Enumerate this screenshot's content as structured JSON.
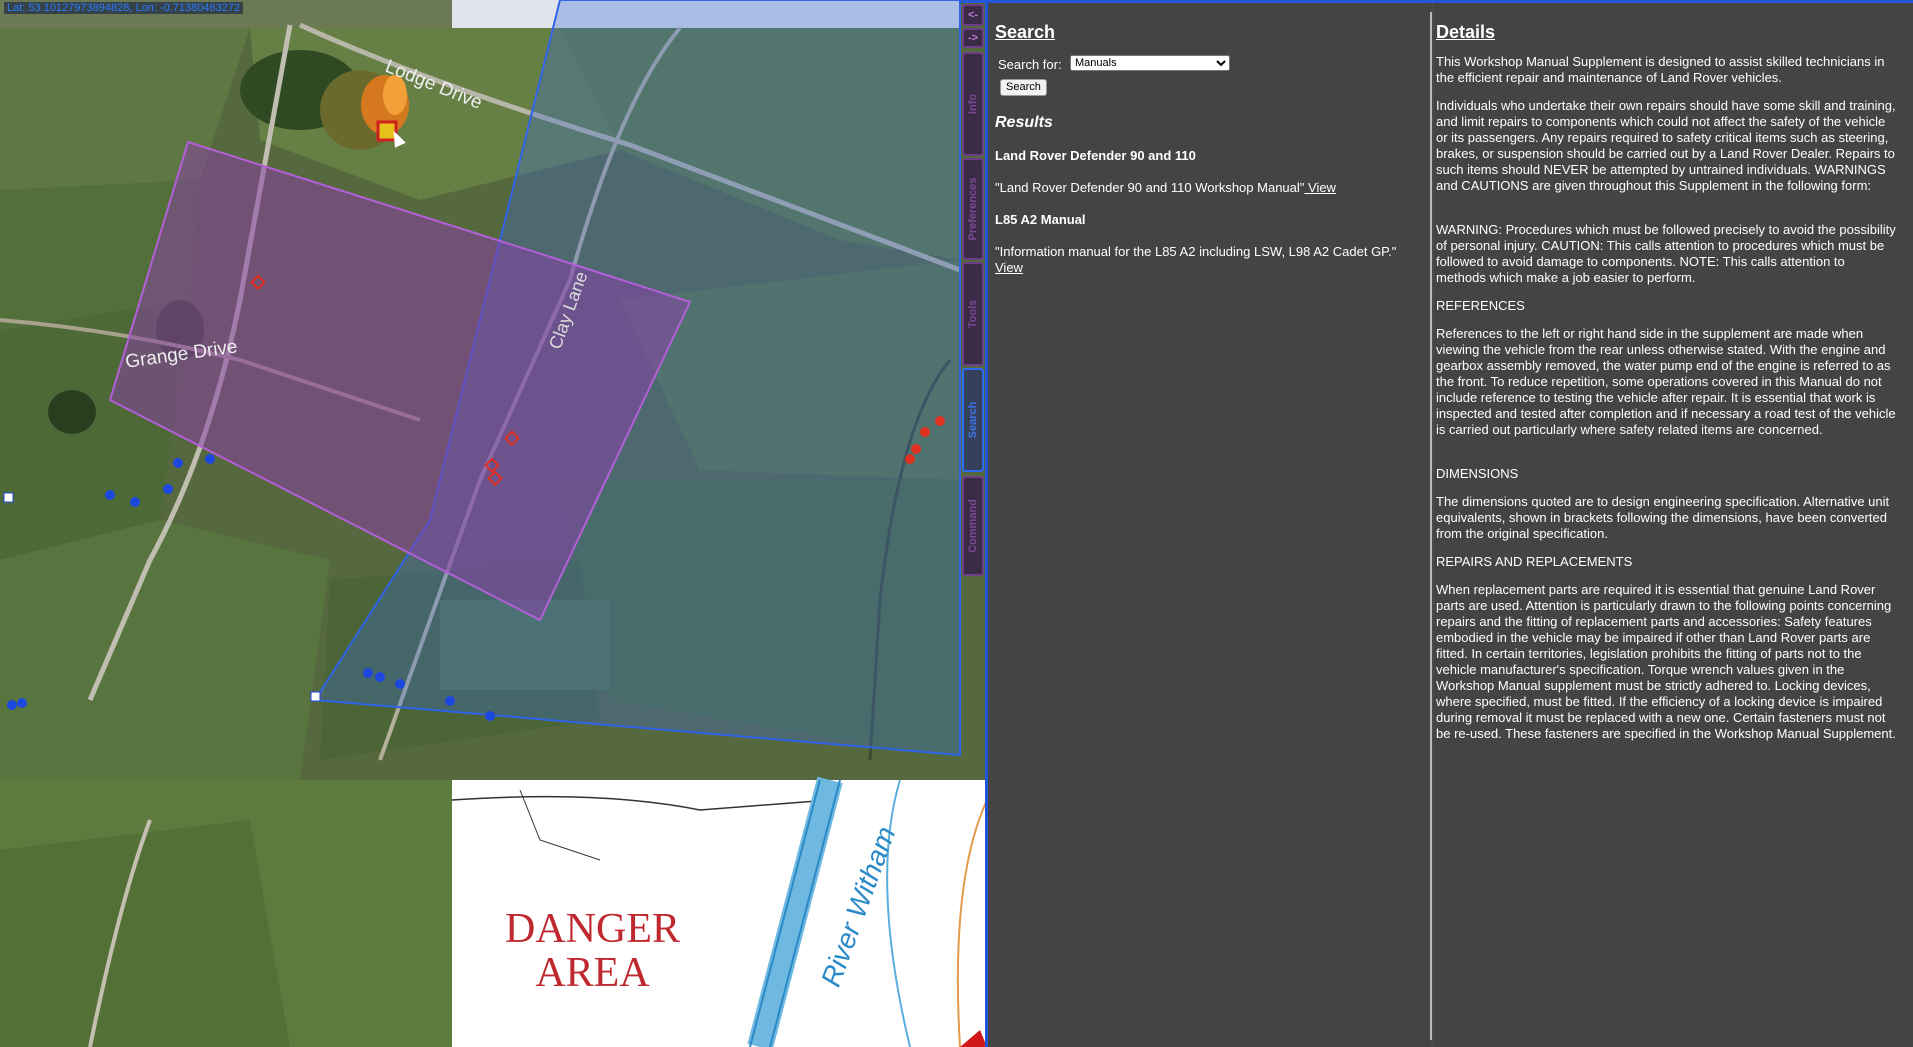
{
  "map": {
    "coords": "Lat: 53.10127973894828, Lon: -0.71380463272",
    "labels": {
      "lodge_drive": "Lodge Drive",
      "clay_lane": "Clay Lane",
      "grange_drive": "Grange Drive",
      "river": "River Witham",
      "danger_line1": "DANGER",
      "danger_line2": "AREA"
    },
    "colors": {
      "purple_zone": "#8a3fa8",
      "blue_zone": "#3c6cd8",
      "red_marker": "#e03020",
      "blue_marker": "#1c48e0"
    }
  },
  "tabs": {
    "back": "<-",
    "forward": "->",
    "info": "Info",
    "preferences": "Preferences",
    "tools": "Tools",
    "search": "Search",
    "command": "Command"
  },
  "search": {
    "title": "Search",
    "search_for_label": "Search for:",
    "selected_option": "Manuals",
    "button": "Search",
    "results_title": "Results",
    "results": [
      {
        "title": "Land Rover Defender 90 and 110",
        "desc": "\"Land Rover Defender 90 and 110 Workshop Manual\"",
        "link": " View"
      },
      {
        "title": "L85 A2 Manual",
        "desc": "\"Information manual for the L85 A2 including LSW, L98 A2 Cadet GP.\"",
        "link": "View"
      }
    ]
  },
  "details": {
    "title": "Details",
    "paragraphs": [
      "This Workshop Manual Supplement is designed to assist skilled technicians in the efficient repair and maintenance of Land Rover vehicles.",
      "Individuals who undertake their own repairs should have some skill and training, and limit repairs to components which could not affect the safety of the vehicle or its passengers. Any repairs required to safety critical items such as steering, brakes, or suspension should be carried out by a Land Rover Dealer. Repairs to such items should NEVER be attempted by untrained individuals. WARNINGS and CAUTIONS are given throughout this Supplement in the following form:",
      "WARNING: Procedures which must be followed precisely to avoid the possibility of personal injury. CAUTION: This calls attention to procedures which must be followed to avoid damage to components. NOTE: This calls attention to methods which make a job easier to perform.",
      "REFERENCES",
      "References to the left or right hand side in the supplement are made when viewing the vehicle from the rear unless otherwise stated. With the engine and gearbox assembly removed, the water pump end of the engine is referred to as the front. To reduce repetition, some operations covered in this Manual do not include reference to testing the vehicle after repair. It is essential that work is inspected and tested after completion and if necessary a road test of the vehicle is carried out particularly where safety related items are concerned.",
      "DIMENSIONS",
      "The dimensions quoted are to design engineering specification. Alternative unit equivalents, shown in brackets following the dimensions, have been converted from the original specification.",
      "REPAIRS AND REPLACEMENTS",
      "When replacement parts are required it is essential that genuine Land Rover parts are used. Attention is particularly drawn to the following points concerning repairs and the fitting of replacement parts and accessories: Safety features embodied in the vehicle may be impaired if other than Land Rover parts are fitted. In certain territories, legislation prohibits the fitting of parts not to the vehicle manufacturer's specification. Torque wrench values given in the Workshop Manual supplement must be strictly adhered to. Locking devices, where specified, must be fitted. If the efficiency of a locking device is impaired during removal it must be replaced with a new one. Certain fasteners must not be re-used. These fasteners are specified in the Workshop Manual Supplement."
    ]
  }
}
